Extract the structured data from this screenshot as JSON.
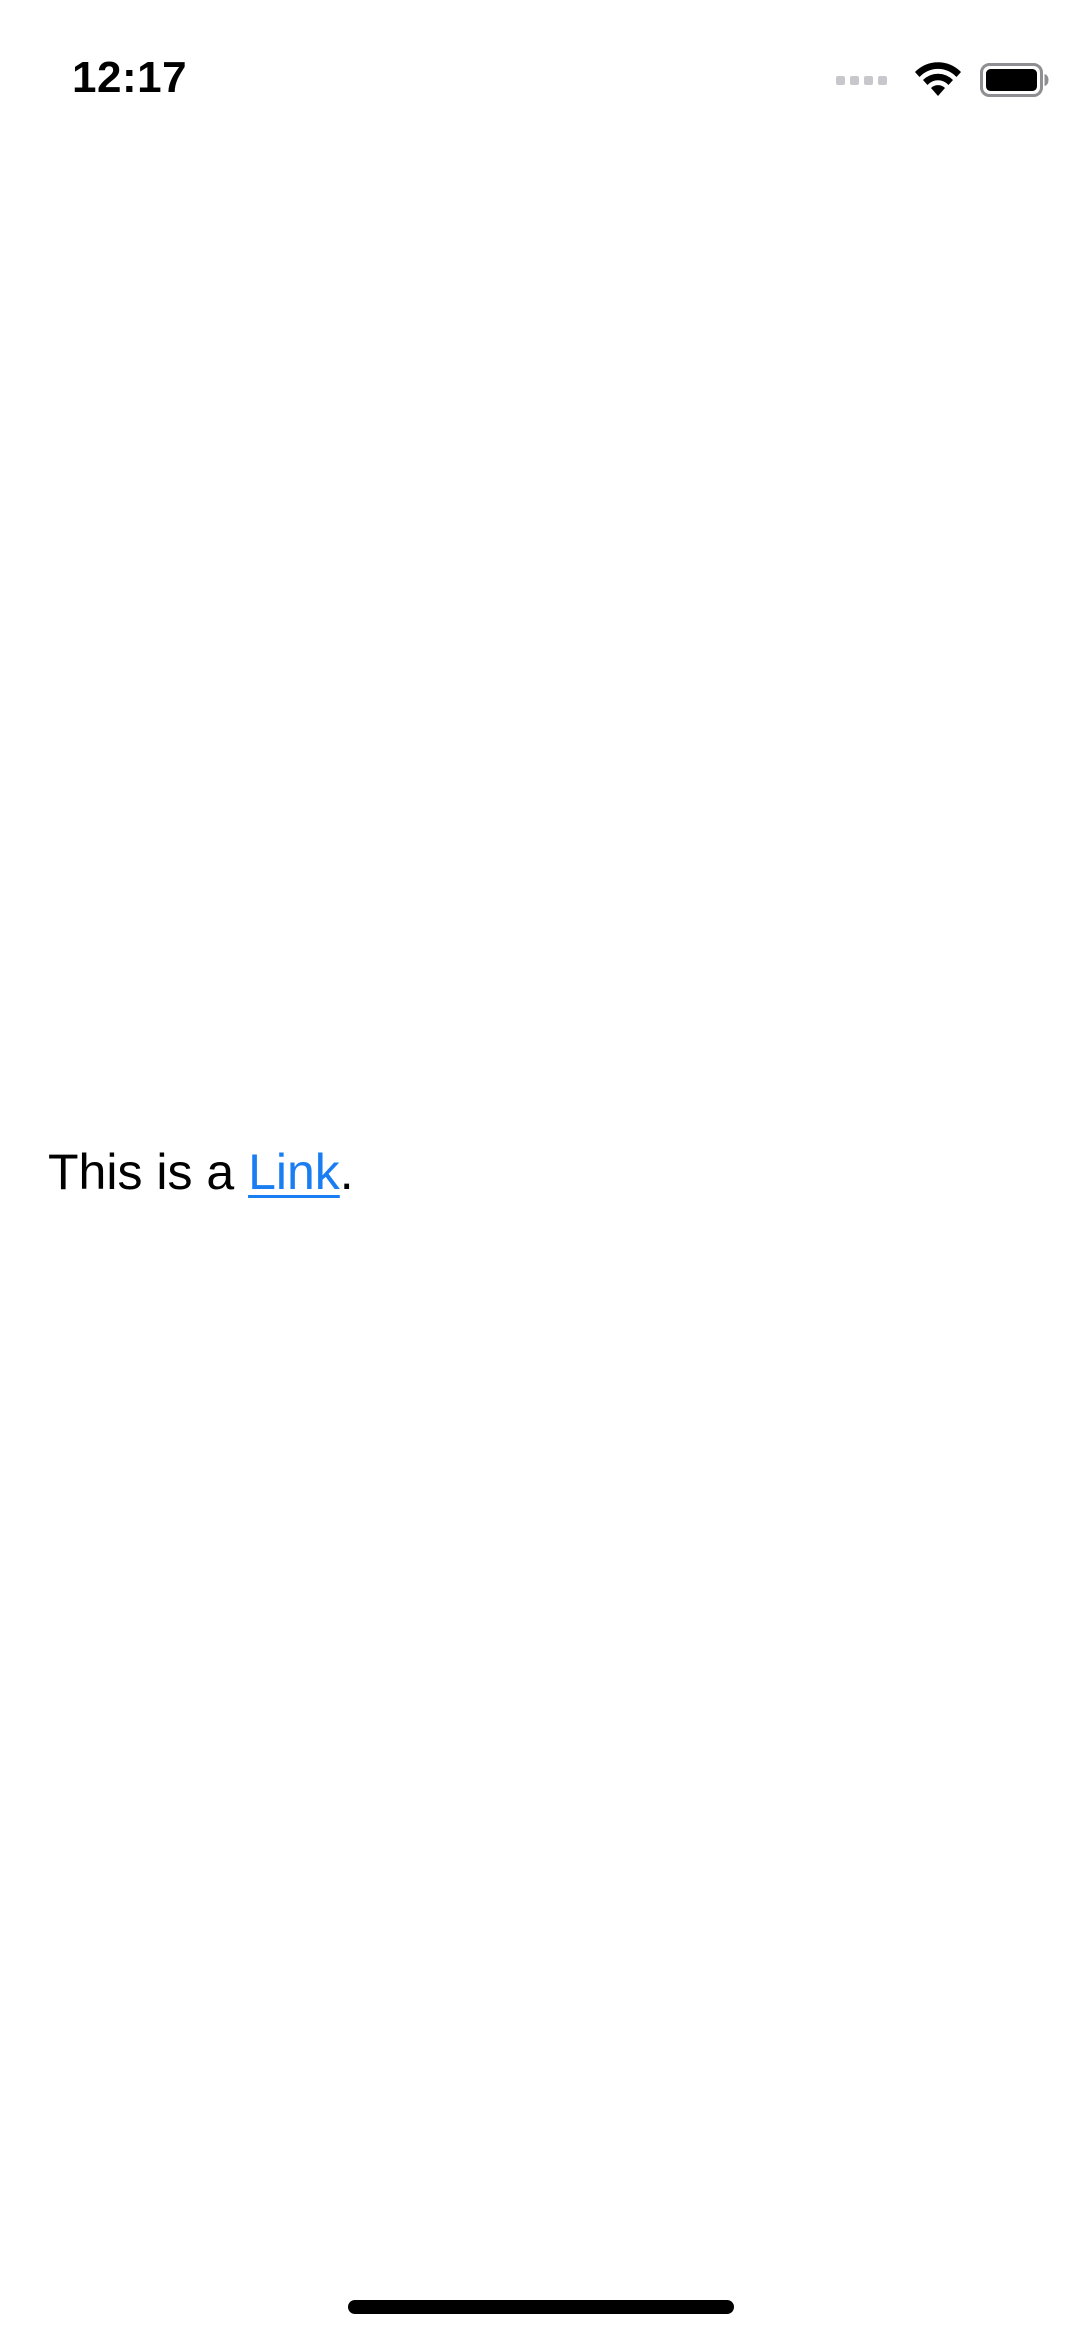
{
  "status_bar": {
    "time": "12:17",
    "icons": [
      "signal-icon",
      "wifi-icon",
      "battery-icon"
    ]
  },
  "content": {
    "prefix_text": "This is a ",
    "link_text": "Link",
    "suffix_text": "."
  },
  "colors": {
    "link": "#1a7ef2",
    "text": "#000000",
    "background": "#ffffff"
  }
}
